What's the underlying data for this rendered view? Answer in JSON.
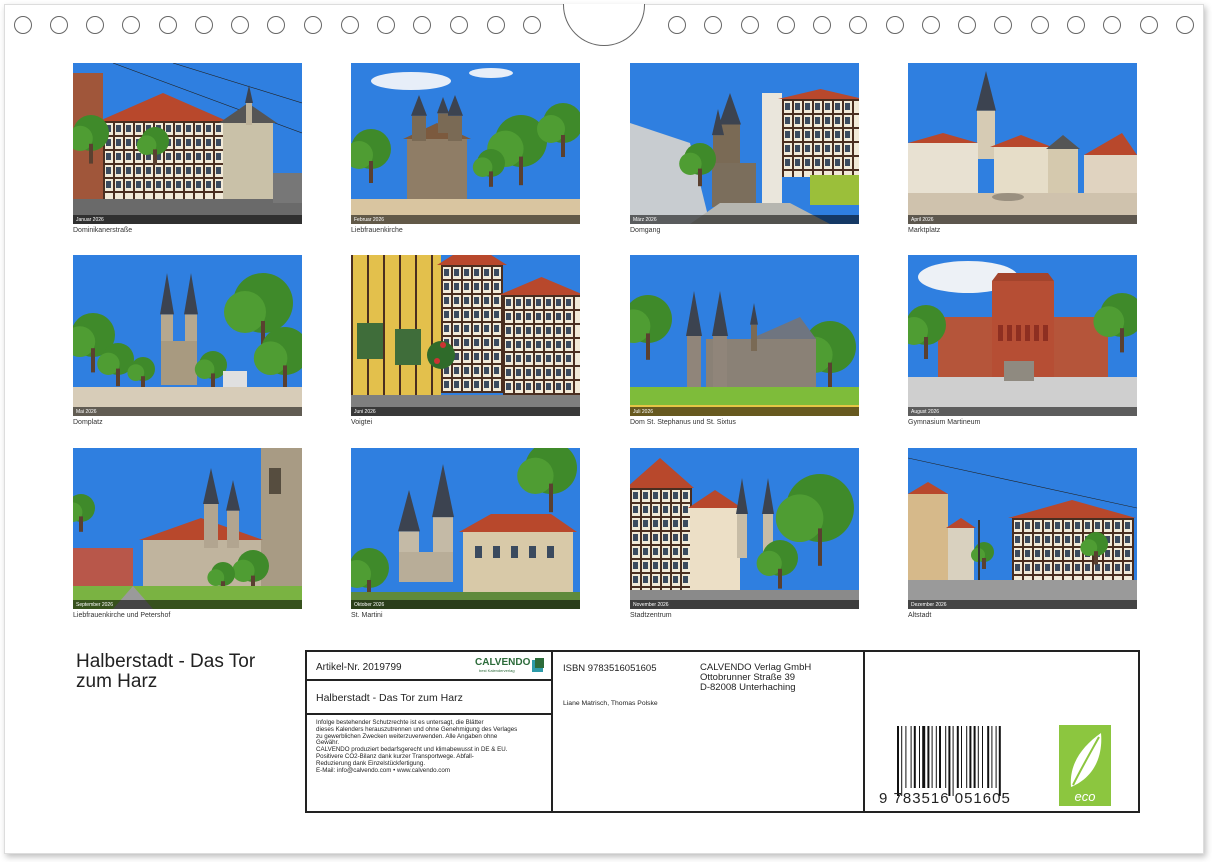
{
  "document": {
    "title": "Halberstadt - Das Tor zum Harz"
  },
  "photos": [
    {
      "caption": "Dominikanerstraße",
      "month": "Januar 2026",
      "scene": "halftimber-street"
    },
    {
      "caption": "Liebfrauenkirche",
      "month": "Februar 2026",
      "scene": "church-towers-trees"
    },
    {
      "caption": "Domgang",
      "month": "März 2026",
      "scene": "domgang-stairs"
    },
    {
      "caption": "Marktplatz",
      "month": "April 2026",
      "scene": "market-square"
    },
    {
      "caption": "Domplatz",
      "month": "Mai 2026",
      "scene": "cathedral-park"
    },
    {
      "caption": "Voigtei",
      "month": "Juni 2026",
      "scene": "voigtei-houses"
    },
    {
      "caption": "Dom St. Stephanus und St. Sixtus",
      "month": "Juli 2026",
      "scene": "cathedral-meadow"
    },
    {
      "caption": "Gymnasium Martineum",
      "month": "August 2026",
      "scene": "brick-school"
    },
    {
      "caption": "Liebfrauenkirche und Petershof",
      "month": "September 2026",
      "scene": "romanesque-church"
    },
    {
      "caption": "St. Martini",
      "month": "Oktober 2026",
      "scene": "martini-towers"
    },
    {
      "caption": "Stadtzentrum",
      "month": "November 2026",
      "scene": "city-street"
    },
    {
      "caption": "Altstadt",
      "month": "Dezember 2026",
      "scene": "old-town-corner"
    }
  ],
  "info": {
    "article_number": "Artikel-Nr. 2019799",
    "logo_text": "CALVENDO",
    "logo_subtext": "best Kalenderverlag",
    "subtitle": "Halberstadt - Das Tor zum Harz",
    "legal_text": "Infolge bestehender Schutzrechte ist es untersagt, die Blätter\ndieses Kalenders herauszutrennen und ohne Genehmigung des Verlages\nzu gewerblichen Zwecken weiterzuverwenden. Alle Angaben ohne\nGewähr.\nCALVENDO produziert bedarfsgerecht und klimabewusst in DE & EU.\nPositivere CO2-Bilanz dank kurzer Transportwege. Abfall-\nReduzierung dank Einzelstückfertigung.\nE-Mail: info@calvendo.com • www.calvendo.com",
    "isbn": "ISBN 9783516051605",
    "authors": "Liane Matrisch, Thomas Polske",
    "publisher": [
      "CALVENDO Verlag GmbH",
      "Ottobrunner Straße 39",
      "D-82008 Unterhaching"
    ],
    "barcode_number": "9 783516 051605",
    "eco_label": "eco"
  },
  "colors": {
    "sky": "#2f7fe0",
    "roof": "#b8482c",
    "foliage": "#3f8a2a",
    "eco_green": "#8cc63f",
    "logo_green": "#2c6b3a"
  }
}
